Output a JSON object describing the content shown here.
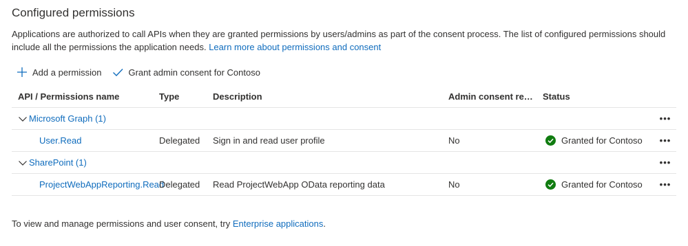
{
  "section": {
    "title": "Configured permissions",
    "intro_text": "Applications are authorized to call APIs when they are granted permissions by users/admins as part of the consent process. The list of configured permissions should include all the permissions the application needs.",
    "intro_link": "Learn more about permissions and consent"
  },
  "toolbar": {
    "add_label": "Add a permission",
    "grant_label": "Grant admin consent for Contoso"
  },
  "table": {
    "columns": {
      "name": "API / Permissions name",
      "type": "Type",
      "description": "Description",
      "admin_consent": "Admin consent requ...",
      "status": "Status"
    },
    "groups": [
      {
        "label": "Microsoft Graph (1)",
        "permissions": [
          {
            "name": "User.Read",
            "type": "Delegated",
            "description": "Sign in and read user profile",
            "admin_consent": "No",
            "status": "Granted for Contoso"
          }
        ]
      },
      {
        "label": "SharePoint (1)",
        "permissions": [
          {
            "name": "ProjectWebAppReporting.Read",
            "type": "Delegated",
            "description": "Read ProjectWebApp OData reporting data",
            "admin_consent": "No",
            "status": "Granted for Contoso"
          }
        ]
      }
    ],
    "more_label": "•••"
  },
  "footer": {
    "text": "To view and manage permissions and user consent, try",
    "link": "Enterprise applications",
    "suffix": "."
  },
  "colors": {
    "link": "#0f6cbd",
    "success": "#107c10",
    "text": "#323130",
    "divider": "#e5e5e5"
  },
  "icons": {
    "add": "plus-icon",
    "grant": "checkmark-icon",
    "expand": "chevron-down-icon",
    "status": "success-check-circle-icon",
    "more": "more-horizontal-icon"
  }
}
